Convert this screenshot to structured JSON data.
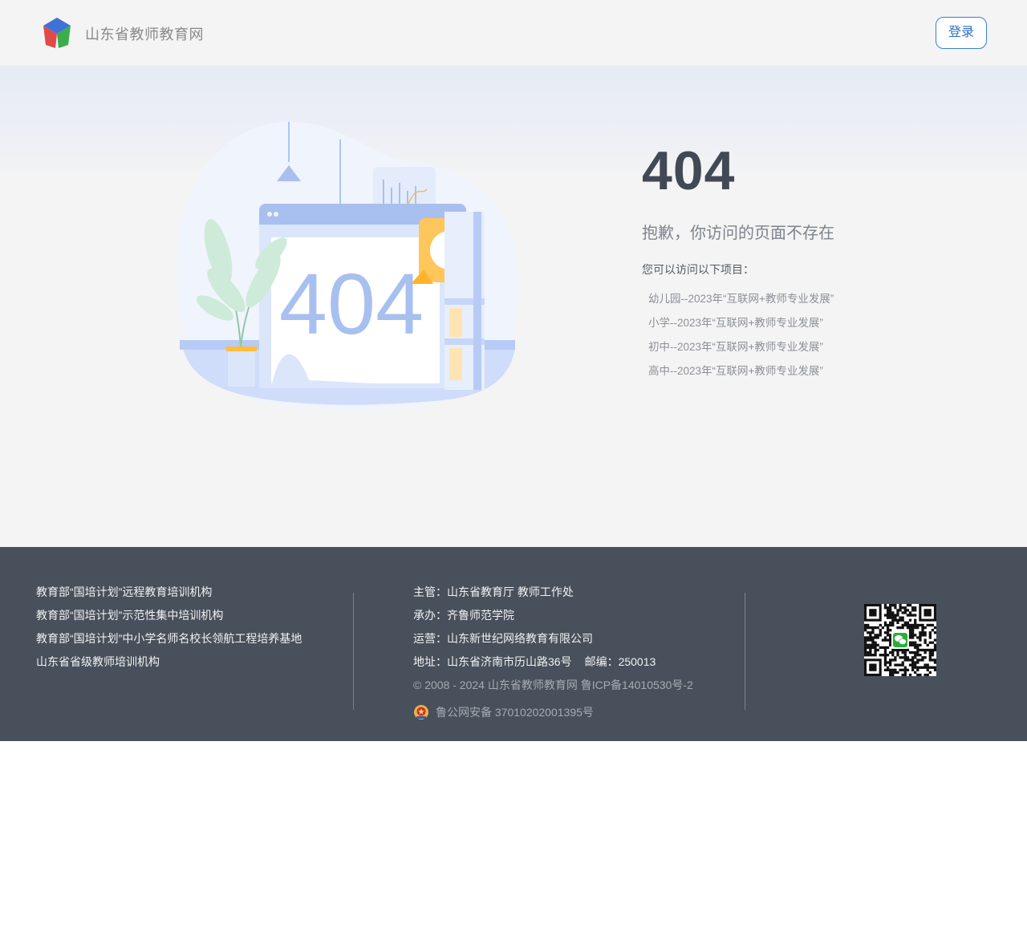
{
  "header": {
    "site_title": "山东省教师教育网",
    "login_label": "登录"
  },
  "main": {
    "illustration_text": "404",
    "error_code": "404",
    "error_message": "抱歉，你访问的页面不存在",
    "visit_label": "您可以访问以下项目：",
    "projects": [
      {
        "label": "幼儿园--2023年“互联网+教师专业发展”"
      },
      {
        "label": "小学--2023年“互联网+教师专业发展”"
      },
      {
        "label": "初中--2023年“互联网+教师专业发展”"
      },
      {
        "label": "高中--2023年“互联网+教师专业发展”"
      }
    ]
  },
  "footer": {
    "institutions": [
      "教育部“国培计划”远程教育培训机构",
      "教育部“国培计划”示范性集中培训机构",
      "教育部“国培计划”中小学名师名校长领航工程培养基地",
      "山东省省级教师培训机构"
    ],
    "supervisor": "主管：山东省教育厅 教师工作处",
    "organizer": "承办：齐鲁师范学院",
    "operator": "运营：山东新世纪网络教育有限公司",
    "address": "地址：山东省济南市历山路36号",
    "postcode": "邮编：250013",
    "copyright": "© 2008 - 2024 山东省教师教育网 鲁ICP备14010530号-2",
    "police_record": "鲁公网安备 37010202001395号"
  },
  "colors": {
    "accent": "#2f6fc0",
    "footer_bg": "#48505b",
    "illustration_blue": "#a8c0ef",
    "illustration_orange": "#ffbe3c"
  },
  "icons": {
    "logo": "cube-logo-icon",
    "police": "police-badge-icon",
    "wechat": "wechat-qr-code"
  }
}
